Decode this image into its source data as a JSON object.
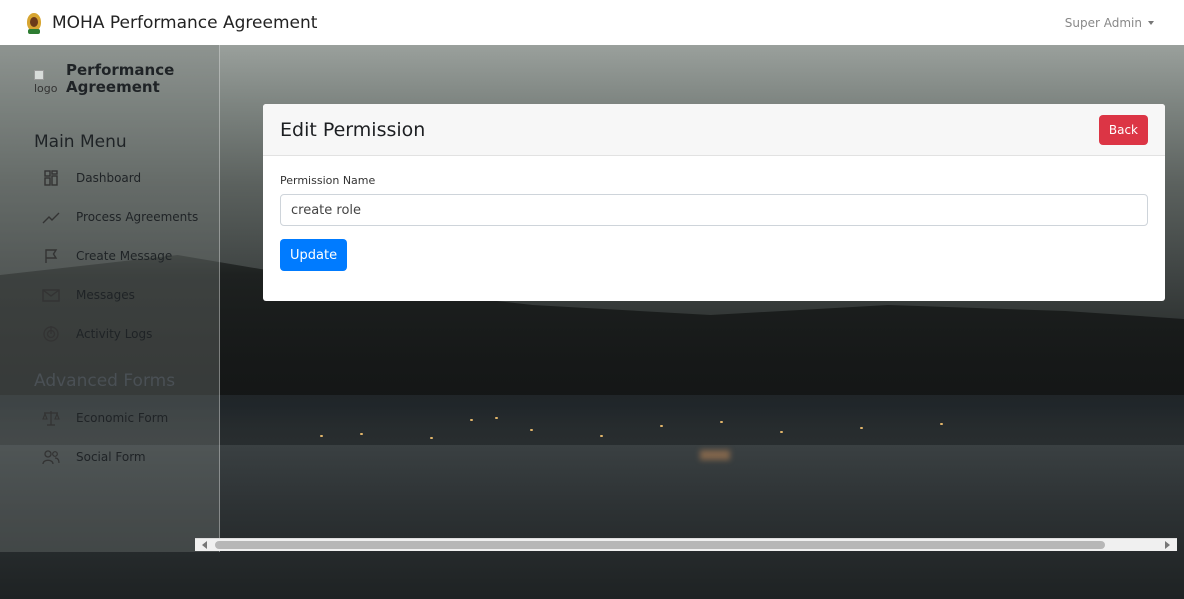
{
  "navbar": {
    "title": "MOHA Performance Agreement",
    "user": "Super Admin",
    "emblem_icon": "national-emblem-icon"
  },
  "sidebar": {
    "logo_alt": "logo",
    "brand_line1": "Performance",
    "brand_line2": "Agreement",
    "main_menu_title": "Main Menu",
    "advanced_title": "Advanced Forms",
    "items": [
      {
        "label": "Dashboard",
        "icon": "dashboard-icon"
      },
      {
        "label": "Process Agreements",
        "icon": "trend-line-icon"
      },
      {
        "label": "Create Message",
        "icon": "flag-icon"
      },
      {
        "label": "Messages",
        "icon": "envelope-icon"
      },
      {
        "label": "Activity Logs",
        "icon": "activity-icon"
      }
    ],
    "advanced_items": [
      {
        "label": "Economic Form",
        "icon": "scales-icon"
      },
      {
        "label": "Social Form",
        "icon": "users-icon"
      }
    ]
  },
  "card": {
    "title": "Edit Permission",
    "back_label": "Back",
    "field_label": "Permission Name",
    "field_value": "create role",
    "update_label": "Update"
  },
  "colors": {
    "danger": "#dc3545",
    "primary": "#007bff"
  }
}
